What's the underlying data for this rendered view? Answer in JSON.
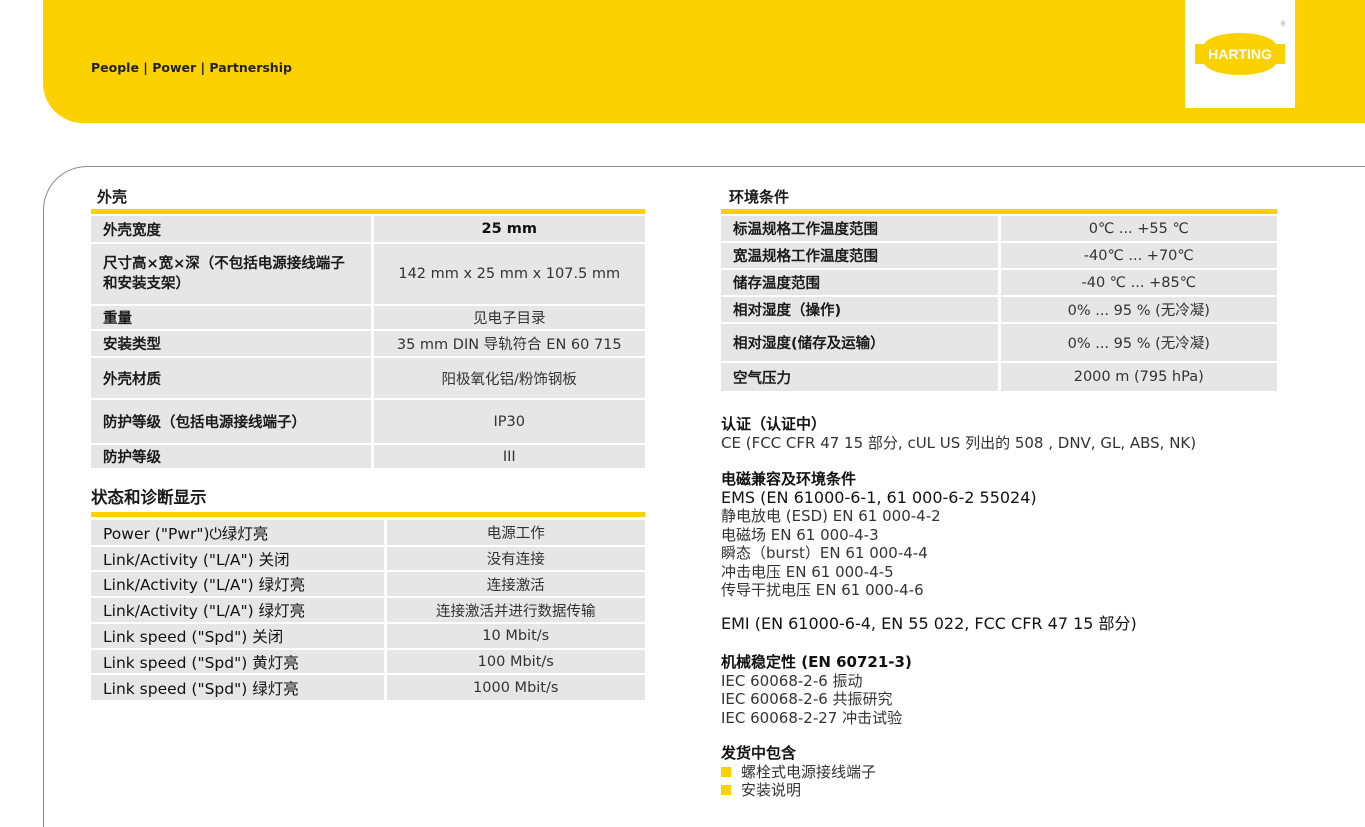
{
  "header": {
    "tagline": "People | Power | Partnership",
    "logo_text": "HARTING",
    "brand_color": "#fcd100"
  },
  "housing": {
    "title": "外壳",
    "rows": [
      {
        "label": "外壳宽度",
        "value": "25 mm"
      },
      {
        "label": "尺寸高×宽×深（不包括电源接线端子和安装支架）",
        "value": "142 mm x 25 mm x 107.5 mm"
      },
      {
        "label": "重量",
        "value": "见电子目录"
      },
      {
        "label": "安装类型",
        "value": "35 mm DIN 导轨符合 EN 60 715"
      },
      {
        "label": "外壳材质",
        "value": "阳极氧化铝/粉饰钢板"
      },
      {
        "label": "防护等级（包括电源接线端子）",
        "value": "IP30"
      },
      {
        "label": "防护等级",
        "value": "III"
      }
    ]
  },
  "status": {
    "title": "状态和诊断显示",
    "rows": [
      {
        "label": "Power (\"Pwr\")⏻绿灯亮",
        "value": "电源工作"
      },
      {
        "label": "Link/Activity (\"L/A\") 关闭",
        "value": "没有连接"
      },
      {
        "label": "Link/Activity (\"L/A\") 绿灯亮",
        "value": "连接激活"
      },
      {
        "label": "Link/Activity (\"L/A\") 绿灯亮",
        "value": "连接激活并进行数据传输"
      },
      {
        "label": "Link speed (\"Spd\") 关闭",
        "value": "10 Mbit/s"
      },
      {
        "label": "Link speed (\"Spd\") 黄灯亮",
        "value": "100 Mbit/s"
      },
      {
        "label": "Link speed (\"Spd\") 绿灯亮",
        "value": "1000 Mbit/s"
      }
    ]
  },
  "environment": {
    "title": "环境条件",
    "rows": [
      {
        "label": "标温规格工作温度范围",
        "value": "0℃ ... +55 ℃"
      },
      {
        "label": "宽温规格工作温度范围",
        "value": "-40℃ ... +70℃"
      },
      {
        "label": "储存温度范围",
        "value": "-40 ℃ ... +85℃"
      },
      {
        "label": "相对湿度（操作)",
        "value": "0% ... 95 % (无冷凝)"
      },
      {
        "label": "相对湿度(储存及运输）",
        "value": "0% ... 95 % (无冷凝)"
      },
      {
        "label": "空气压力",
        "value": "2000 m (795 hPa)"
      }
    ]
  },
  "certification": {
    "title": "认证（认证中）",
    "text": "CE (FCC CFR 47 15 部分, cUL US 列出的 508 , DNV, GL, ABS, NK)"
  },
  "emc": {
    "title": "电磁兼容及环境条件",
    "ems": "EMS (EN 61000-6-1, 61 000-6-2 55024)",
    "items": [
      "静电放电 (ESD) EN 61 000-4-2",
      "电磁场 EN 61 000-4-3",
      "瞬态（burst）EN 61 000-4-4",
      "冲击电压 EN 61 000-4-5",
      "传导干扰电压 EN 61 000-4-6"
    ],
    "emi": "EMI (EN 61000-6-4, EN 55 022, FCC CFR 47 15 部分)"
  },
  "mechanical": {
    "title": "机械稳定性 (EN 60721-3)",
    "items": [
      "IEC 60068-2-6 振动",
      "IEC 60068-2-6 共振研究",
      "IEC 60068-2-27 冲击试验"
    ]
  },
  "delivery": {
    "title": "发货中包含",
    "items": [
      "螺栓式电源接线端子",
      "安装说明"
    ]
  }
}
